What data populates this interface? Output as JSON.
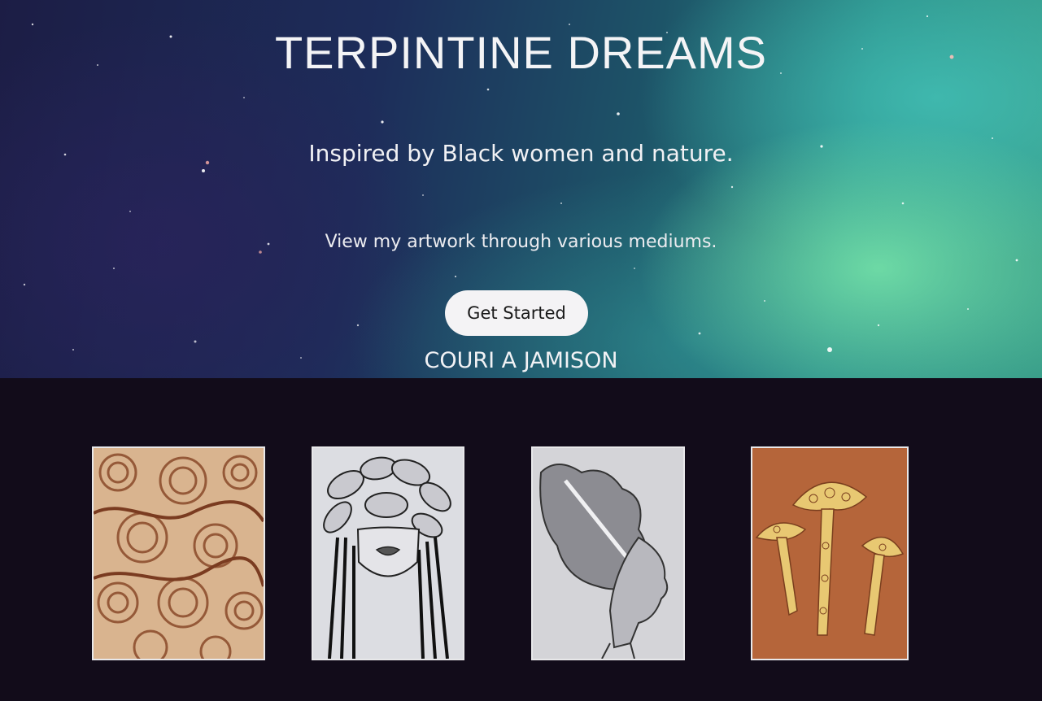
{
  "hero": {
    "title": "TERPINTINE DREAMS",
    "subtitle": "Inspired by Black women and nature.",
    "description": "View my artwork through various mediums.",
    "cta_label": "Get Started",
    "artist_name": "COURI A JAMISON"
  },
  "colors": {
    "page_background": "#120c1a",
    "button_background": "#f4f3f5",
    "card_border": "#e8e8ea"
  },
  "gallery": {
    "items": [
      {
        "name": "artwork-swirl-pattern",
        "icon": "swirl-pattern-artwork"
      },
      {
        "name": "artwork-leaf-crown-portrait",
        "icon": "leaf-crown-portrait-artwork"
      },
      {
        "name": "artwork-profile-hair-portrait",
        "icon": "profile-portrait-artwork"
      },
      {
        "name": "artwork-mushrooms",
        "icon": "mushrooms-artwork"
      }
    ]
  }
}
